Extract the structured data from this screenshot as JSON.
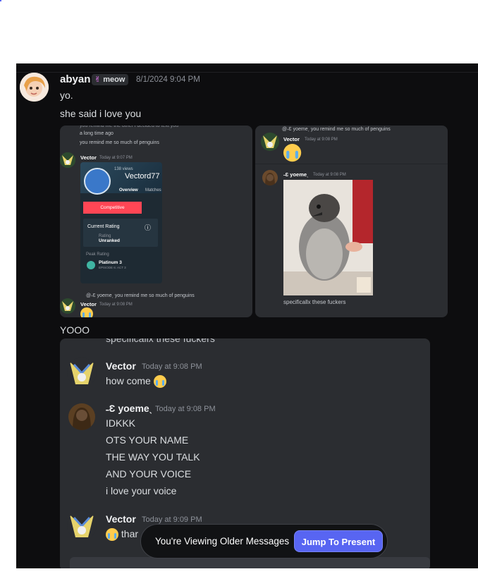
{
  "first_message": {
    "username": "abyan",
    "tag": "meow",
    "timestamp": "8/1/2024 9:04 PM",
    "lines": [
      "yo.",
      "she said i love you"
    ]
  },
  "attachment_left": {
    "top_lines": [
      "a long time ago",
      "you remind me so much of penguins"
    ],
    "vector_name": "Vector",
    "vector_ts": "Today at 9:07 PM",
    "card": {
      "views": "138 views",
      "player": "Vectord77",
      "tab1": "Overview",
      "tab2": "Matches",
      "mode": "Competitive",
      "current_rating_label": "Current Rating",
      "rating_sub": "Rating",
      "rating_value": "Unranked",
      "peak_label": "Peak Rating",
      "peak_value": "Platinum 3",
      "peak_sub": "EPISODE 6: ACT 3"
    },
    "reply_preview": "@˗Ɛ yoemeˎ you remind me so much of penguins",
    "reply_name": "Vector",
    "reply_ts": "Today at 9:08 PM"
  },
  "attachment_right": {
    "reply_preview": "@˗Ɛ yoemeˎ you remind me so much of penguins",
    "vector_name": "Vector",
    "vector_ts": "Today at 9:08 PM",
    "yoeme_name": "˗Ɛ yoemeˎ",
    "yoeme_ts": "Today at 9:08 PM",
    "caption": "specificallx these fuckers"
  },
  "yooo_text": "YOOO",
  "big_snapshot": {
    "cut_line": "specificallx these fuckers",
    "messages": [
      {
        "name": "Vector",
        "ts": "Today at 9:08 PM",
        "lines": [
          "how come"
        ]
      },
      {
        "name": "˗Ɛ yoemeˎ",
        "ts": "Today at 9:08 PM",
        "lines": [
          "IDKKK",
          "OTS YOUR NAME",
          "THE WAY YOU TALK",
          "AND YOUR VOICE",
          "i love your voice"
        ]
      },
      {
        "name": "Vector",
        "ts": "Today at 9:09 PM",
        "lines": [
          "thar"
        ]
      }
    ]
  },
  "banner": {
    "text": "You're Viewing Older Messages",
    "button": "Jump To Present"
  },
  "colors": {
    "accent": "#5865f2",
    "background": "#0d0d0f",
    "panel": "#2b2d31"
  }
}
